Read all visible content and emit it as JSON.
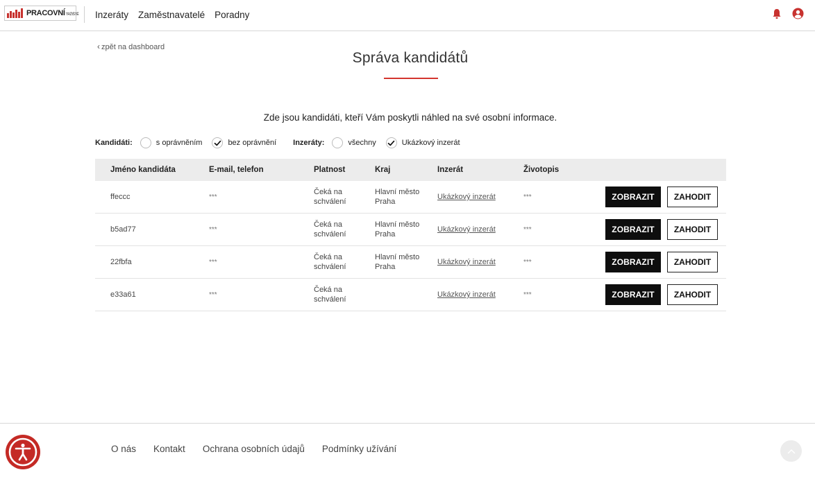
{
  "header": {
    "logo_text": "PRACOVNÍ",
    "logo_small": "TRŽIŠTĚ",
    "nav": [
      "Inzeráty",
      "Zaměstnavatelé",
      "Poradny"
    ]
  },
  "back_link": "zpět na dashboard",
  "page_title": "Správa kandidátů",
  "subtitle": "Zde jsou kandidáti, kteří Vám poskytli náhled na své osobní informace.",
  "filters": {
    "candidates_label": "Kandidáti:",
    "candidates_options": [
      {
        "label": "s oprávněním",
        "checked": false
      },
      {
        "label": "bez oprávnění",
        "checked": true
      }
    ],
    "ads_label": "Inzeráty:",
    "ads_options": [
      {
        "label": "všechny",
        "checked": false
      },
      {
        "label": "Ukázkový inzerát",
        "checked": true
      }
    ]
  },
  "table": {
    "headers": [
      "Jméno kandidáta",
      "E-mail, telefon",
      "Platnost",
      "Kraj",
      "Inzerát",
      "Životopis"
    ],
    "rows": [
      {
        "name": "ffeccc",
        "contact": "***",
        "validity_1": "Čeká na",
        "validity_2": "schválení",
        "region_1": "Hlavní město",
        "region_2": "Praha",
        "ad": "Ukázkový inzerát",
        "cv": "***"
      },
      {
        "name": "b5ad77",
        "contact": "***",
        "validity_1": "Čeká na",
        "validity_2": "schválení",
        "region_1": "Hlavní město",
        "region_2": "Praha",
        "ad": "Ukázkový inzerát",
        "cv": "***"
      },
      {
        "name": "22fbfa",
        "contact": "***",
        "validity_1": "Čeká na",
        "validity_2": "schválení",
        "region_1": "Hlavní město",
        "region_2": "Praha",
        "ad": "Ukázkový inzerát",
        "cv": "***"
      },
      {
        "name": "e33a61",
        "contact": "***",
        "validity_1": "Čeká na",
        "validity_2": "schválení",
        "region_1": "",
        "region_2": "",
        "ad": "Ukázkový inzerát",
        "cv": "***"
      }
    ],
    "view_label": "ZOBRAZIT",
    "drop_label": "ZAHODIT"
  },
  "footer": {
    "links": [
      "O nás",
      "Kontakt",
      "Ochrana osobních údajů",
      "Podmínky užívání"
    ]
  },
  "colors": {
    "accent": "#d3352f",
    "button_dark": "#0e0e0e",
    "header_row": "#ececec"
  },
  "icons": {
    "bell": "bell-icon",
    "user": "user-circle-icon",
    "accessibility": "accessibility-icon",
    "scroll_top": "chevron-up-icon",
    "check": "check-icon"
  }
}
